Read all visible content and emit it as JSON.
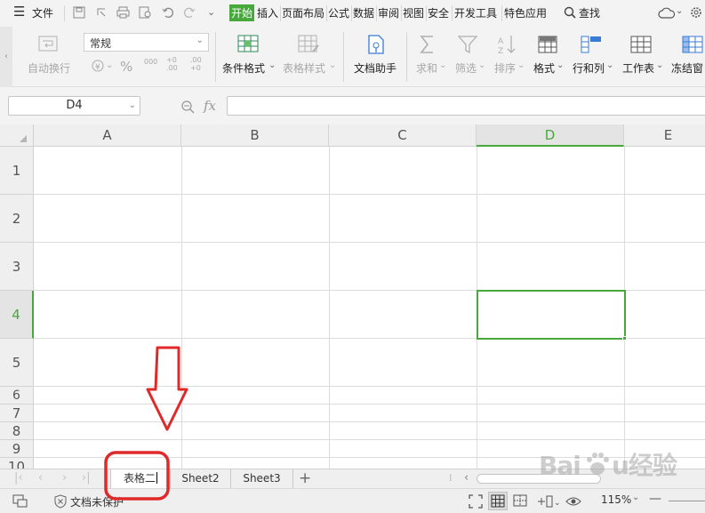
{
  "menu": {
    "file_label": "文件",
    "tabs": [
      "开始",
      "插入",
      "页面布局",
      "公式",
      "数据",
      "审阅",
      "视图",
      "安全",
      "开发工具",
      "特色应用"
    ],
    "search_label": "查找"
  },
  "ribbon": {
    "wrap_label": "自动换行",
    "number_format_value": "常规",
    "percent_symbol": "%",
    "thousands_symbol": "000",
    "dec_increase_symbol": "+0 .00",
    "dec_decrease_symbol": ".00 +0",
    "cond_format_label": "条件格式",
    "table_style_label": "表格样式",
    "doc_helper_label": "文档助手",
    "sum_label": "求和",
    "filter_label": "筛选",
    "sort_label": "排序",
    "format_label": "格式",
    "rowcol_label": "行和列",
    "worksheet_label": "工作表",
    "freeze_label": "冻结窗"
  },
  "formula_bar": {
    "cell_ref": "D4",
    "fx_label": "fx",
    "formula_value": ""
  },
  "grid": {
    "columns": [
      "A",
      "B",
      "C",
      "D",
      "E"
    ],
    "rows": [
      "1",
      "2",
      "3",
      "4",
      "5",
      "6",
      "7",
      "8",
      "9",
      "10"
    ],
    "selected_column": "D",
    "selected_row": "4"
  },
  "sheets": {
    "tabs": [
      "表格二",
      "Sheet2",
      "Sheet3"
    ],
    "active_index": 0,
    "add_label": "+"
  },
  "status": {
    "protect_label": "文档未保护",
    "zoom_label": "115%",
    "zoom_minus": "—"
  },
  "watermark": {
    "text": "Baidu经验"
  },
  "colors": {
    "accent": "#47a93c",
    "annotation": "#e02a2a"
  }
}
